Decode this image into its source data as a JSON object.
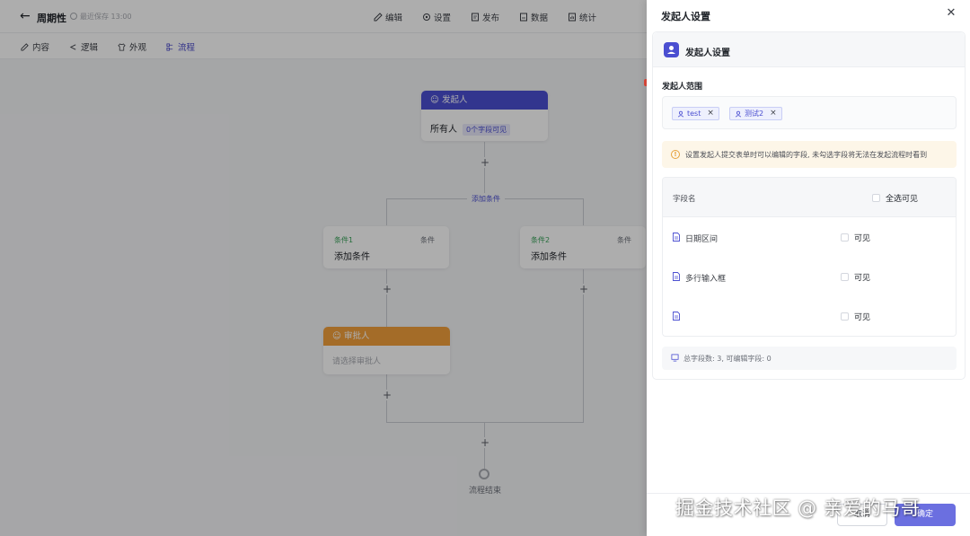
{
  "header": {
    "form_title": "周期性",
    "save_status": "最近保存 13:00",
    "nav": [
      {
        "label": "编辑",
        "icon": "edit-icon"
      },
      {
        "label": "设置",
        "icon": "gear-icon"
      },
      {
        "label": "发布",
        "icon": "publish-icon"
      },
      {
        "label": "数据",
        "icon": "data-icon"
      },
      {
        "label": "统计",
        "icon": "stats-icon"
      }
    ]
  },
  "subtabs": [
    {
      "label": "内容",
      "icon": "edit-icon"
    },
    {
      "label": "逻辑",
      "icon": "logic-icon"
    },
    {
      "label": "外观",
      "icon": "shirt-icon"
    },
    {
      "label": "流程",
      "icon": "flow-icon",
      "active": true
    }
  ],
  "flow": {
    "initiator_node": {
      "title": "发起人",
      "body": "所有人",
      "badge": "0个字段可见"
    },
    "add_condition": "添加条件",
    "branches": [
      {
        "name": "条件1",
        "tag": "条件",
        "body": "添加条件"
      },
      {
        "name": "条件2",
        "tag": "条件",
        "body": "添加条件"
      }
    ],
    "approver_node": {
      "title": "审批人",
      "body": "请选择审批人"
    },
    "end_label": "流程结束",
    "colors": {
      "initiator": "#4b4fd1",
      "approver": "#f2a03c",
      "condition": "#3aa35b"
    }
  },
  "drawer": {
    "title": "发起人设置",
    "section_title": "发起人设置",
    "range_label": "发起人范围",
    "chips": [
      "test",
      "测试2"
    ],
    "tip": "设置发起人提交表单时可以编辑的字段, 未勾选字段将无法在发起流程时看到",
    "table": {
      "col_name": "字段名",
      "select_all": "全选可见",
      "rows": [
        {
          "name": "日期区间",
          "visible_label": "可见"
        },
        {
          "name": "多行输入框",
          "visible_label": "可见"
        },
        {
          "name": "",
          "visible_label": "可见"
        }
      ]
    },
    "summary": "总字段数: 3, 可编辑字段: 0",
    "cancel_label": "取消",
    "ok_label": "确定"
  },
  "watermark": "掘金技术社区 @ 亲爱的马哥",
  "accent_color": "#4b4fd1"
}
